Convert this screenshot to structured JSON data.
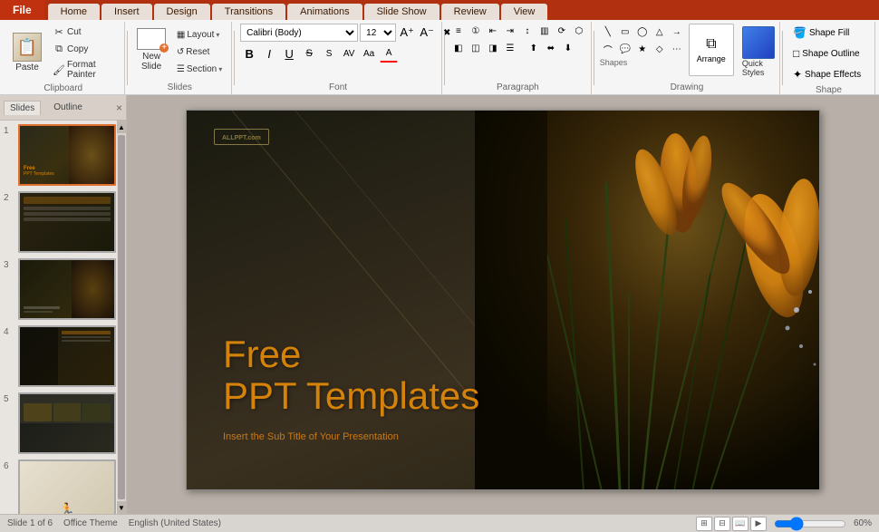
{
  "titlebar": {
    "file_label": "File",
    "tabs": [
      "Home",
      "Insert",
      "Design",
      "Transitions",
      "Animations",
      "Slide Show",
      "Review",
      "View"
    ]
  },
  "ribbon": {
    "groups": {
      "clipboard": {
        "label": "Clipboard",
        "paste_label": "Paste",
        "cut_label": "Cut",
        "copy_label": "Copy",
        "format_painter_label": "Format Painter"
      },
      "slides": {
        "label": "Slides",
        "new_slide_label": "New Slide",
        "layout_label": "Layout",
        "reset_label": "Reset",
        "section_label": "Section"
      },
      "font": {
        "label": "Font",
        "font_name": "Calibri (Body)",
        "font_size": "12",
        "bold": "B",
        "italic": "I",
        "underline": "U",
        "strikethrough": "S",
        "shadow": "S",
        "char_spacing": "AV",
        "change_case": "Aa",
        "font_color": "A"
      },
      "paragraph": {
        "label": "Paragraph",
        "bullets_label": "Bullets",
        "numbering_label": "Numbering",
        "decrease_indent": "Decrease Indent",
        "increase_indent": "Increase Indent",
        "line_spacing": "Line Spacing",
        "columns": "Columns",
        "align_left": "Align Left",
        "center": "Center",
        "align_right": "Align Right",
        "justify": "Justify",
        "text_direction": "Text Direction",
        "smart_art": "Convert to SmartArt"
      },
      "drawing": {
        "label": "Drawing",
        "shapes_label": "Shapes",
        "arrange_label": "Arrange",
        "quick_styles_label": "Quick Styles"
      },
      "shape_fill": {
        "label": "Shape",
        "shape_fill_label": "Shape Fill",
        "shape_outline_label": "Shape Outline",
        "shape_effects_label": "Shape Effects"
      }
    }
  },
  "slide_panel": {
    "slides_tab": "Slides",
    "outline_tab": "Outline",
    "close_label": "×",
    "slides": [
      {
        "num": "1",
        "active": true
      },
      {
        "num": "2",
        "active": false
      },
      {
        "num": "3",
        "active": false
      },
      {
        "num": "4",
        "active": false
      },
      {
        "num": "5",
        "active": false
      },
      {
        "num": "6",
        "active": false
      }
    ]
  },
  "slide": {
    "logo": "ALLPPT",
    "logo_sub": ".com",
    "title_line1": "Free",
    "title_line2": "PPT Templates",
    "subtitle": "Insert the Sub Title of Your Presentation"
  },
  "status_bar": {
    "slide_info": "Slide 1 of 6",
    "theme_label": "Office Theme",
    "language": "English (United States)",
    "zoom_label": "60%",
    "normal_view": "Normal",
    "slide_sorter": "Slide Sorter",
    "reading_view": "Reading View",
    "slide_show": "Slide Show"
  }
}
